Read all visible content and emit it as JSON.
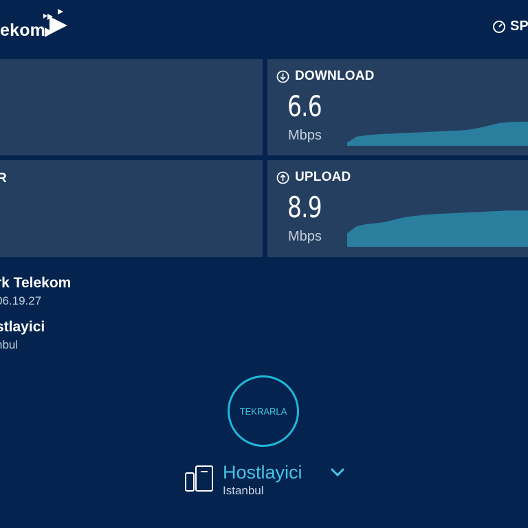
{
  "header": {
    "logo_text": "ekom",
    "speedtest_fragment": "SP"
  },
  "left_panel": {
    "label_fragment": "R"
  },
  "download": {
    "title": "DOWNLOAD",
    "value": "6.6",
    "unit": "Mbps",
    "icon": "arrow-down-circle-icon",
    "graph_level": [
      0.07,
      0.2,
      0.23,
      0.25,
      0.26,
      0.27,
      0.28,
      0.29,
      0.3,
      0.31,
      0.32,
      0.33,
      0.34,
      0.36,
      0.4,
      0.45,
      0.5,
      0.52,
      0.53,
      0.53
    ]
  },
  "upload": {
    "title": "UPLOAD",
    "value": "8.9",
    "unit": "Mbps",
    "icon": "arrow-up-circle-icon",
    "graph_level": [
      0.3,
      0.45,
      0.5,
      0.52,
      0.55,
      0.6,
      0.65,
      0.68,
      0.7,
      0.72,
      0.73,
      0.74,
      0.75,
      0.76,
      0.77,
      0.78,
      0.79,
      0.8,
      0.8,
      0.8
    ]
  },
  "isp": {
    "name": "rk Telekom",
    "ip": "06.19.27"
  },
  "host": {
    "name": "stlayici",
    "city": "nbul"
  },
  "again_button": "TEKRARLA",
  "server": {
    "name": "Hostlayici",
    "city": "Istanbul",
    "icon": "server-icon"
  },
  "colors": {
    "background": "#04244f",
    "panel": "#253f61",
    "graph": "#2a7f9e",
    "accent": "#1fb7d8"
  }
}
